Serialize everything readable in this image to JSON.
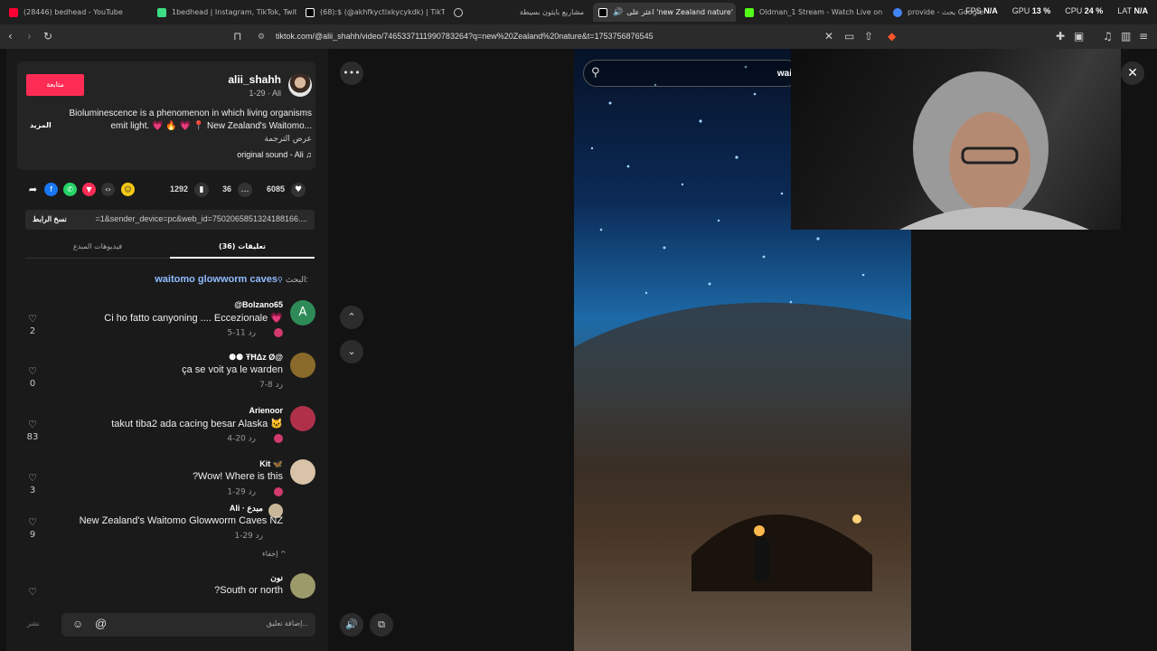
{
  "tabs": [
    {
      "title": "(28446) bedhead - YouTube",
      "color": "#ff0033"
    },
    {
      "title": "1bedhead | Instagram, TikTok, Twitch",
      "color": "#3ddc84"
    },
    {
      "title": "(68):$ (@akhfkyctixkycykdk) | TikTok",
      "color": "#ffffff"
    },
    {
      "title": "",
      "color": "#cccccc"
    },
    {
      "title": "مشاريع بايثون بسيطة",
      "color": "#cccccc"
    },
    {
      "title": "اعثر على 'new Zealand nature'",
      "color": "#ffffff"
    },
    {
      "title": "Oldman_1 Stream - Watch Live on Kick",
      "color": "#53fc18"
    },
    {
      "title": "provide - بحث Google",
      "color": "#4285f4"
    }
  ],
  "perf": {
    "fps_label": "FPS",
    "fps_value": "N/A",
    "gpu_label": "GPU",
    "gpu_value": "13 %",
    "cpu_label": "CPU",
    "cpu_value": "24 %",
    "lat_label": "LAT",
    "lat_value": "N/A"
  },
  "url": "tiktok.com/@alii_shahh/video/7465337111990783264?q=new%20Zealand%20nature&t=1753756876545",
  "post": {
    "follow_label": "متابعة",
    "username": "alii_shahh",
    "date_line": "1-29 · Ali",
    "desc_line1": "Bioluminescence is a phenomenon in which living organisms",
    "desc_line2": "emit light. 💗 🔥 💗 📍 New Zealand's Waitomo...",
    "more_label": "المزيد",
    "translate_label": "عرض الترجمة",
    "sound": "original sound - Ali ♫"
  },
  "stats": {
    "likes": "6085",
    "comments": "36",
    "saves": "1292"
  },
  "link": {
    "url": "=1&sender_device=pc&web_id=7502065851324188166....",
    "copy_label": "نسخ الرابط"
  },
  "comment_tabs": {
    "comments": "(36) تعليقات",
    "videos": "فيديوهات المبدع"
  },
  "search": {
    "label": "البحث:",
    "term": "waitomo glowworm caves"
  },
  "comments": [
    {
      "name": "@Bolzano65",
      "text": "Ci ho fatto canyoning .... Eccezionale 💗",
      "meta": "5-11   رد",
      "likes": "2",
      "avatar_color": "#2e8b57",
      "avatar_letter": "A"
    },
    {
      "name": "⚈⚈ ŦĦΔz Ø@",
      "text": "ça se voit ya le warden",
      "meta": "7-8   رد",
      "likes": "0",
      "avatar_color": "#8a6a2a",
      "avatar_letter": ""
    },
    {
      "name": "Arienoor",
      "text": "takut tiba2 ada cacing besar Alaska 🐱",
      "meta": "4-20   رد",
      "likes": "83",
      "avatar_color": "#b0304a",
      "avatar_letter": ""
    },
    {
      "name": "Kit 🦋",
      "text": "?Wow! Where is this",
      "meta": "1-29   رد",
      "likes": "3",
      "avatar_color": "#d8c2a8",
      "avatar_letter": ""
    },
    {
      "name": "Ali · مبدع",
      "text": "New Zealand's Waitomo Glowworm Caves NZ",
      "meta": "1-29   رد",
      "likes": "9",
      "avatar_color": "#c9b79a",
      "avatar_letter": ""
    },
    {
      "name": "نون",
      "text": "?South or north",
      "meta": "",
      "likes": "",
      "avatar_color": "#9c9a6a",
      "avatar_letter": ""
    }
  ],
  "hide_label": "إخفاء ^",
  "input_placeholder": "إضافة تعليق...",
  "post_label": "نشر",
  "video_search_text": "wai"
}
